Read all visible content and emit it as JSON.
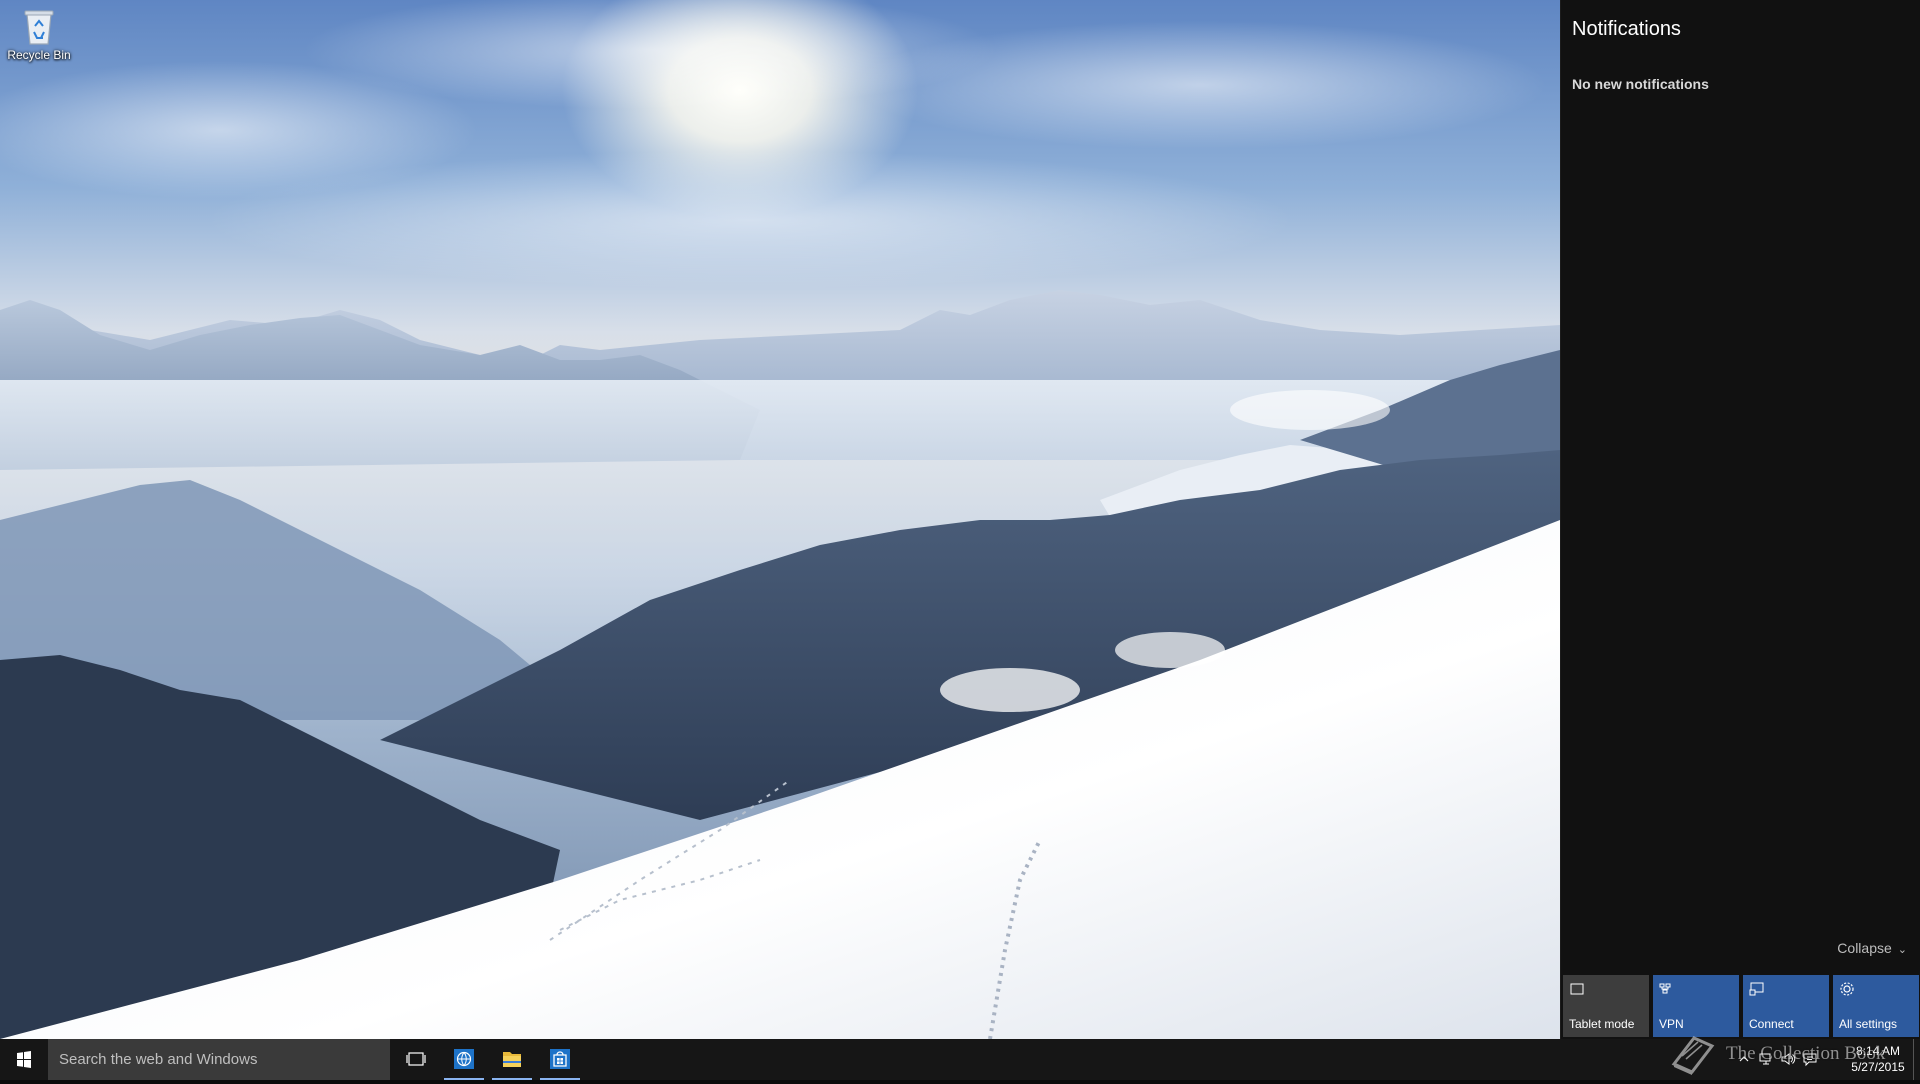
{
  "desktop": {
    "icons": [
      {
        "label": "Recycle Bin",
        "icon": "recycle-bin-icon"
      }
    ]
  },
  "action_center": {
    "title": "Notifications",
    "empty_message": "No new notifications",
    "collapse_label": "Collapse",
    "quick_actions": [
      {
        "label": "Tablet mode",
        "icon": "tablet-icon",
        "state": "off"
      },
      {
        "label": "VPN",
        "icon": "vpn-icon",
        "state": "on"
      },
      {
        "label": "Connect",
        "icon": "connect-icon",
        "state": "on"
      },
      {
        "label": "All settings",
        "icon": "gear-icon",
        "state": "on"
      }
    ],
    "colors": {
      "panel_bg": "#111111",
      "tile_on": "#2d5a9e",
      "tile_off": "#3d3d3d"
    }
  },
  "taskbar": {
    "search_placeholder": "Search the web and Windows",
    "pinned": [
      {
        "name": "task-view",
        "icon": "task-view-icon"
      },
      {
        "name": "internet-explorer",
        "icon": "browser-icon"
      },
      {
        "name": "file-explorer",
        "icon": "folder-icon"
      },
      {
        "name": "store",
        "icon": "store-icon"
      }
    ],
    "tray": {
      "time": "8:14 AM",
      "date": "5/27/2015",
      "icons": [
        "chevron-up-icon",
        "network-icon",
        "volume-icon",
        "action-center-icon"
      ]
    }
  },
  "watermark": {
    "text": "The Collection Book"
  }
}
